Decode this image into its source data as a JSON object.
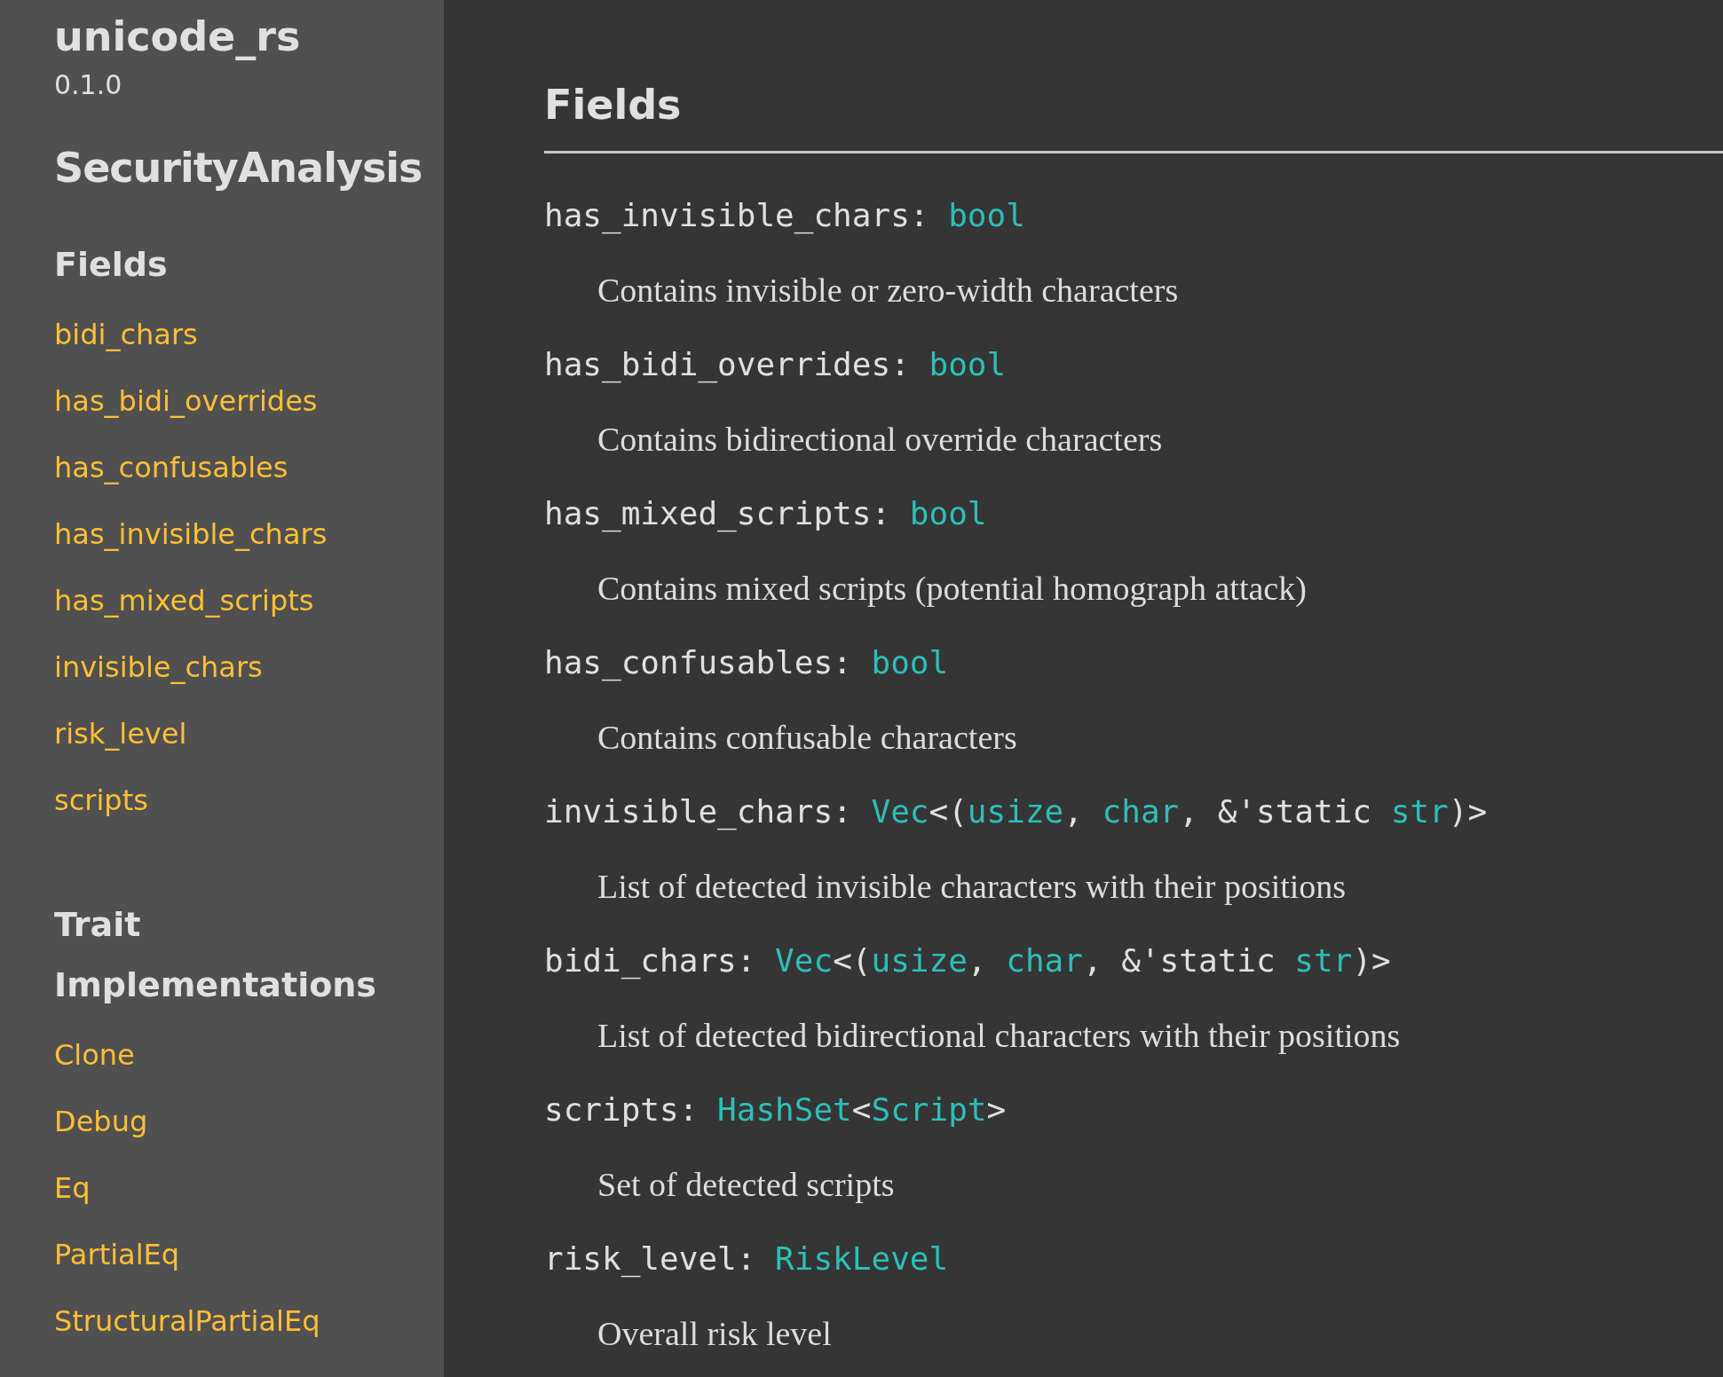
{
  "sidebar": {
    "crate_name": "unicode_rs",
    "version": "0.1.0",
    "item_title": "SecurityAnalysis",
    "sections": [
      {
        "heading": "Fields",
        "links": [
          "bidi_chars",
          "has_bidi_overrides",
          "has_confusables",
          "has_invisible_chars",
          "has_mixed_scripts",
          "invisible_chars",
          "risk_level",
          "scripts"
        ]
      },
      {
        "heading": "Trait Implementations",
        "links": [
          "Clone",
          "Debug",
          "Eq",
          "PartialEq",
          "StructuralPartialEq"
        ]
      }
    ]
  },
  "main": {
    "heading": "Fields",
    "fields": [
      {
        "signature": [
          {
            "kind": "plain",
            "text": "has_invisible_chars: "
          },
          {
            "kind": "type",
            "text": "bool"
          }
        ],
        "description": "Contains invisible or zero-width characters"
      },
      {
        "signature": [
          {
            "kind": "plain",
            "text": "has_bidi_overrides: "
          },
          {
            "kind": "type",
            "text": "bool"
          }
        ],
        "description": "Contains bidirectional override characters"
      },
      {
        "signature": [
          {
            "kind": "plain",
            "text": "has_mixed_scripts: "
          },
          {
            "kind": "type",
            "text": "bool"
          }
        ],
        "description": "Contains mixed scripts (potential homograph attack)"
      },
      {
        "signature": [
          {
            "kind": "plain",
            "text": "has_confusables: "
          },
          {
            "kind": "type",
            "text": "bool"
          }
        ],
        "description": "Contains confusable characters"
      },
      {
        "signature": [
          {
            "kind": "plain",
            "text": "invisible_chars: "
          },
          {
            "kind": "type",
            "text": "Vec"
          },
          {
            "kind": "plain",
            "text": "<("
          },
          {
            "kind": "type",
            "text": "usize"
          },
          {
            "kind": "plain",
            "text": ", "
          },
          {
            "kind": "type",
            "text": "char"
          },
          {
            "kind": "plain",
            "text": ", &'static "
          },
          {
            "kind": "type",
            "text": "str"
          },
          {
            "kind": "plain",
            "text": ")>"
          }
        ],
        "description": "List of detected invisible characters with their positions"
      },
      {
        "signature": [
          {
            "kind": "plain",
            "text": "bidi_chars: "
          },
          {
            "kind": "type",
            "text": "Vec"
          },
          {
            "kind": "plain",
            "text": "<("
          },
          {
            "kind": "type",
            "text": "usize"
          },
          {
            "kind": "plain",
            "text": ", "
          },
          {
            "kind": "type",
            "text": "char"
          },
          {
            "kind": "plain",
            "text": ", &'static "
          },
          {
            "kind": "type",
            "text": "str"
          },
          {
            "kind": "plain",
            "text": ")>"
          }
        ],
        "description": "List of detected bidirectional characters with their positions"
      },
      {
        "signature": [
          {
            "kind": "plain",
            "text": "scripts: "
          },
          {
            "kind": "type",
            "text": "HashSet"
          },
          {
            "kind": "plain",
            "text": "<"
          },
          {
            "kind": "type",
            "text": "Script"
          },
          {
            "kind": "plain",
            "text": ">"
          }
        ],
        "description": "Set of detected scripts"
      },
      {
        "signature": [
          {
            "kind": "plain",
            "text": "risk_level: "
          },
          {
            "kind": "type",
            "text": "RiskLevel"
          }
        ],
        "description": "Overall risk level"
      }
    ]
  }
}
